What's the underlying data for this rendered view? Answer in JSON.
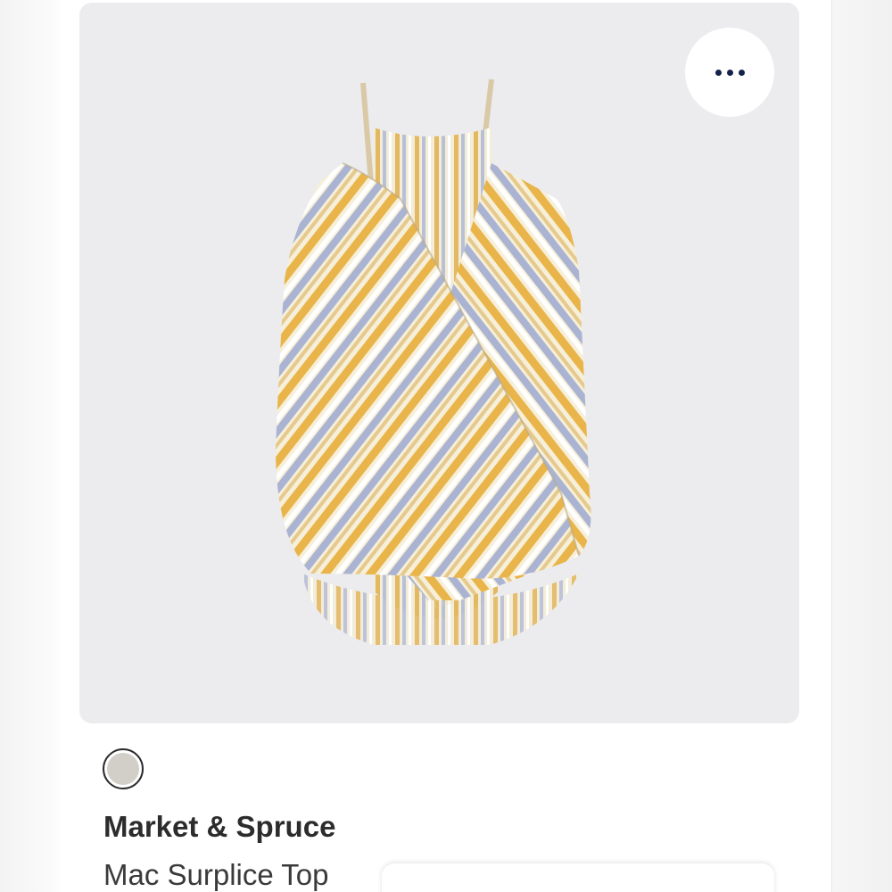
{
  "product": {
    "brand": "Market & Spruce",
    "name": "Mac Surplice Top",
    "image_alt": "Striped surplice cami top",
    "swatch_color": "#d2cfc8"
  },
  "actions": {
    "more_icon": "more-horizontal-icon"
  },
  "colors": {
    "stripe_yellow": "#e9b54a",
    "stripe_blue": "#aab4d2",
    "stripe_cream": "#f6efd9",
    "panel_bg": "#ececee",
    "dots": "#15224d"
  }
}
